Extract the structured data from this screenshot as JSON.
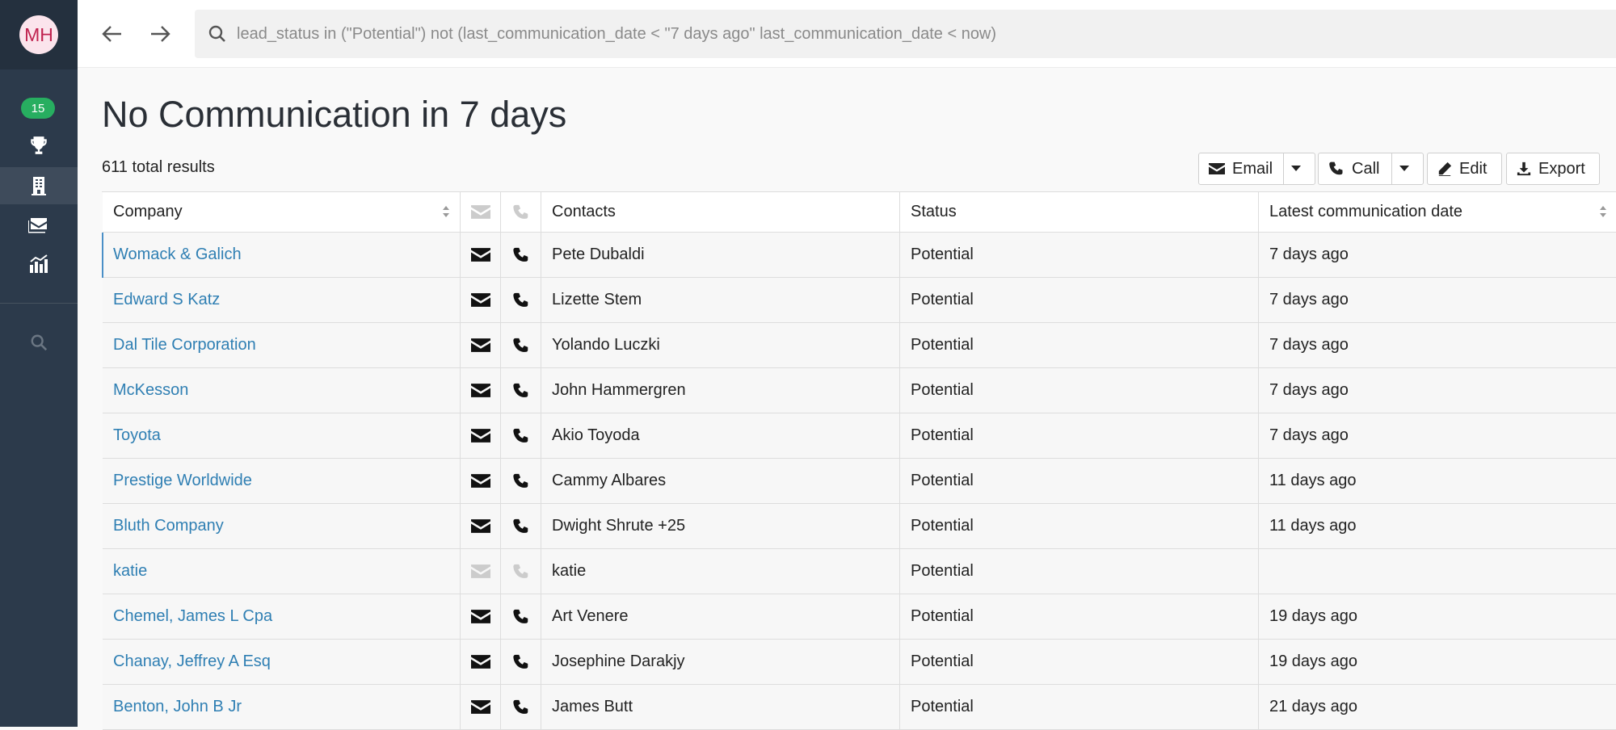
{
  "sidebar": {
    "avatar_initials": "MH",
    "badge_count": "15",
    "items": [
      {
        "icon": "trophy-icon"
      },
      {
        "icon": "building-icon",
        "active": true
      },
      {
        "icon": "mail-icon"
      },
      {
        "icon": "reports-chart-icon"
      },
      {
        "icon": "search-icon"
      }
    ]
  },
  "topbar": {
    "search_query": "lead_status in (\"Potential\") not (last_communication_date < \"7 days ago\" last_communication_date < now)"
  },
  "page": {
    "title": "No Communication in 7 days",
    "total_results": "611 total results"
  },
  "toolbar": {
    "email_label": "Email",
    "call_label": "Call",
    "edit_label": "Edit",
    "export_label": "Export"
  },
  "table": {
    "columns": [
      "Company",
      "Contacts",
      "Status",
      "Latest communication date"
    ],
    "rows": [
      {
        "company": "Womack & Galich",
        "contacts": "Pete Dubaldi",
        "status": "Potential",
        "latest": "7 days ago",
        "has_contact_info": true
      },
      {
        "company": "Edward S Katz",
        "contacts": "Lizette Stem",
        "status": "Potential",
        "latest": "7 days ago",
        "has_contact_info": true
      },
      {
        "company": "Dal Tile Corporation",
        "contacts": "Yolando Luczki",
        "status": "Potential",
        "latest": "7 days ago",
        "has_contact_info": true
      },
      {
        "company": "McKesson",
        "contacts": "John Hammergren",
        "status": "Potential",
        "latest": "7 days ago",
        "has_contact_info": true
      },
      {
        "company": "Toyota",
        "contacts": "Akio Toyoda",
        "status": "Potential",
        "latest": "7 days ago",
        "has_contact_info": true
      },
      {
        "company": "Prestige Worldwide",
        "contacts": "Cammy Albares",
        "status": "Potential",
        "latest": "11 days ago",
        "has_contact_info": true
      },
      {
        "company": "Bluth Company",
        "contacts": "Dwight Shrute +25",
        "status": "Potential",
        "latest": "11 days ago",
        "has_contact_info": true
      },
      {
        "company": "katie",
        "contacts": "katie",
        "status": "Potential",
        "latest": "",
        "has_contact_info": false
      },
      {
        "company": "Chemel, James L Cpa",
        "contacts": "Art Venere",
        "status": "Potential",
        "latest": "19 days ago",
        "has_contact_info": true
      },
      {
        "company": "Chanay, Jeffrey A Esq",
        "contacts": "Josephine Darakjy",
        "status": "Potential",
        "latest": "19 days ago",
        "has_contact_info": true
      },
      {
        "company": "Benton, John B Jr",
        "contacts": "James Butt",
        "status": "Potential",
        "latest": "21 days ago",
        "has_contact_info": true
      }
    ]
  },
  "colors": {
    "sidebar_bg": "#2c3a4b",
    "link": "#2f7fb3",
    "badge": "#27ae60",
    "avatar_bg": "#fbe4ec",
    "avatar_text": "#c0224f"
  }
}
